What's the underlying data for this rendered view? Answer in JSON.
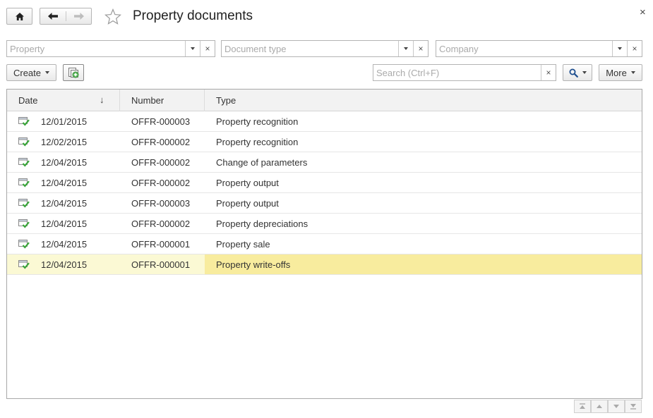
{
  "window": {
    "title": "Property documents",
    "close_label": "×"
  },
  "filters": {
    "property": {
      "placeholder": "Property",
      "clear": "×"
    },
    "document_type": {
      "placeholder": "Document type",
      "clear": "×"
    },
    "company": {
      "placeholder": "Company",
      "clear": "×"
    }
  },
  "toolbar": {
    "create_label": "Create",
    "search_placeholder": "Search (Ctrl+F)",
    "search_clear": "×",
    "more_label": "More"
  },
  "table": {
    "columns": [
      "Date",
      "Number",
      "Type"
    ],
    "sort_indicator": "↓",
    "rows": [
      {
        "date": "12/01/2015",
        "number": "OFFR-000003",
        "type": "Property recognition"
      },
      {
        "date": "12/02/2015",
        "number": "OFFR-000002",
        "type": "Property recognition"
      },
      {
        "date": "12/04/2015",
        "number": "OFFR-000002",
        "type": "Change of parameters"
      },
      {
        "date": "12/04/2015",
        "number": "OFFR-000002",
        "type": "Property output"
      },
      {
        "date": "12/04/2015",
        "number": "OFFR-000003",
        "type": "Property output"
      },
      {
        "date": "12/04/2015",
        "number": "OFFR-000002",
        "type": "Property depreciations"
      },
      {
        "date": "12/04/2015",
        "number": "OFFR-000001",
        "type": "Property sale"
      },
      {
        "date": "12/04/2015",
        "number": "OFFR-000001",
        "type": "Property write-offs"
      }
    ],
    "selected_row": 7
  },
  "icons": {
    "home": "home-icon",
    "back": "arrow-left-icon",
    "forward": "arrow-right-icon",
    "favorite": "star-icon",
    "copy": "copy-document-icon",
    "search": "magnifier-icon",
    "row_status": "document-posted-icon"
  },
  "colors": {
    "selected_row": "#fbf9d4",
    "selected_cell": "#f8ec9e",
    "header_bg": "#f2f2f2"
  }
}
